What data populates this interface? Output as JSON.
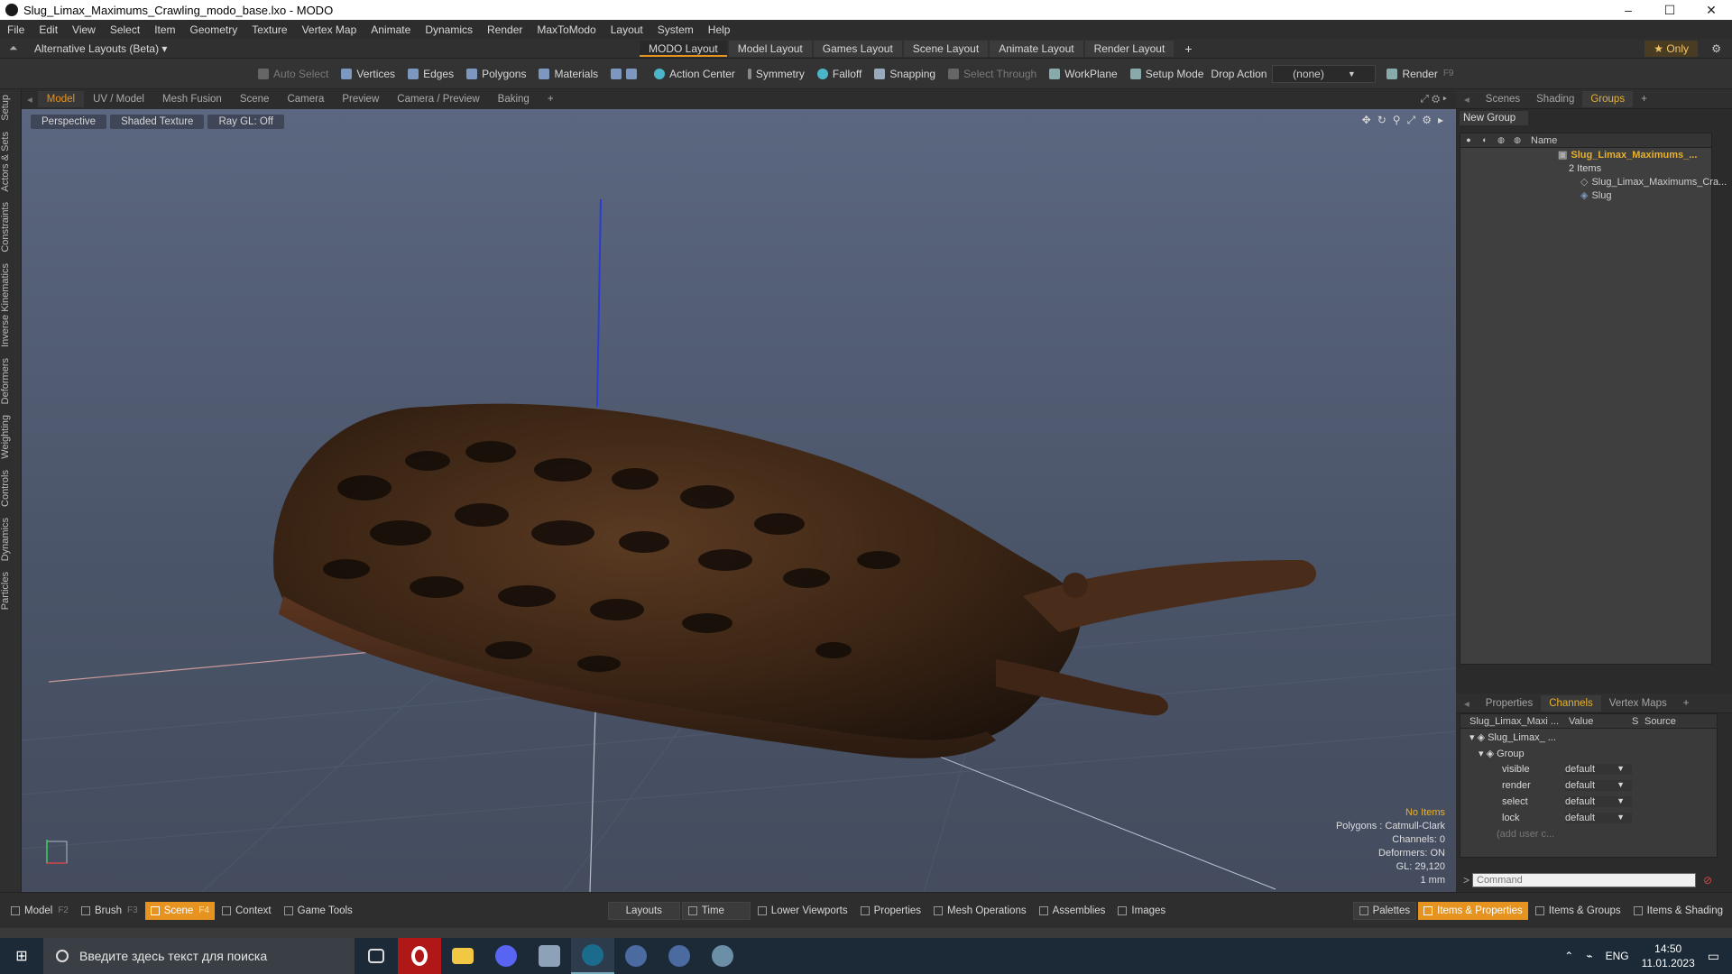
{
  "window": {
    "title": "Slug_Limax_Maximums_Crawling_modo_base.lxo - MODO",
    "controls": [
      "–",
      "☐",
      "✕"
    ]
  },
  "menu": [
    "File",
    "Edit",
    "View",
    "Select",
    "Item",
    "Geometry",
    "Texture",
    "Vertex Map",
    "Animate",
    "Dynamics",
    "Render",
    "MaxToModo",
    "Layout",
    "System",
    "Help"
  ],
  "layoutbar": {
    "alt_layouts": "Alternative Layouts (Beta) ▾",
    "tabs": [
      "MODO Layout",
      "Model Layout",
      "Games Layout",
      "Scene Layout",
      "Animate Layout",
      "Render Layout"
    ],
    "add": "+",
    "only": "★ Only"
  },
  "toolbar": {
    "auto_select": "Auto Select",
    "vertices": "Vertices",
    "edges": "Edges",
    "polygons": "Polygons",
    "materials": "Materials",
    "action_center": "Action Center",
    "symmetry": "Symmetry",
    "falloff": "Falloff",
    "snapping": "Snapping",
    "select_through": "Select Through",
    "workplane": "WorkPlane",
    "setup_mode": "Setup Mode",
    "drop_action": "Drop Action",
    "drop_value": "(none)",
    "render": "Render",
    "render_key": "F9"
  },
  "left_tabs": [
    "Setup",
    "Actors & Sets",
    "Constraints",
    "Inverse Kinematics",
    "Deformers",
    "Weighting",
    "Controls",
    "Dynamics",
    "Particles"
  ],
  "view_tabs": [
    "Model",
    "UV / Model",
    "Mesh Fusion",
    "Scene",
    "Camera",
    "Preview",
    "Camera / Preview",
    "Baking",
    "+"
  ],
  "viewport": {
    "perspective": "Perspective",
    "shading": "Shaded Texture",
    "raygl": "Ray GL: Off",
    "stats": {
      "no_items": "No Items",
      "polygons": "Polygons : Catmull-Clark",
      "channels": "Channels: 0",
      "deformers": "Deformers: ON",
      "gl": "GL: 29,120",
      "scale": "1 mm"
    }
  },
  "right_panel": {
    "tabs": [
      "Scenes",
      "Shading",
      "Groups",
      "+"
    ],
    "new_group": "New Group",
    "name_header": "Name",
    "group_name": "Slug_Limax_Maximums_...",
    "group_count": "2 Items",
    "items": [
      "Slug_Limax_Maximums_Cra...",
      "Slug"
    ]
  },
  "lower_panel": {
    "tabs": [
      "Properties",
      "Channels",
      "Vertex Maps",
      "+"
    ],
    "headers": {
      "name": "Slug_Limax_Maxi ...",
      "value": "Value",
      "s": "S",
      "source": "Source"
    },
    "root": "Slug_Limax_ ...",
    "group": "Group",
    "channels": [
      {
        "name": "visible",
        "value": "default"
      },
      {
        "name": "render",
        "value": "default"
      },
      {
        "name": "select",
        "value": "default"
      },
      {
        "name": "lock",
        "value": "default"
      }
    ],
    "add_user": "(add user c...",
    "command_placeholder": "Command"
  },
  "bottombar": {
    "left": [
      {
        "label": "Model",
        "key": "F2"
      },
      {
        "label": "Brush",
        "key": "F3"
      },
      {
        "label": "Scene",
        "key": "F4"
      },
      {
        "label": "Context",
        "key": ""
      },
      {
        "label": "Game Tools",
        "key": ""
      }
    ],
    "mid": [
      "Layouts",
      "Time",
      "Lower Viewports",
      "Properties",
      "Mesh Operations",
      "Assemblies",
      "Images"
    ],
    "right": [
      "Palettes",
      "Items & Properties",
      "Items & Groups",
      "Items & Shading"
    ]
  },
  "taskbar": {
    "search_placeholder": "Введите здесь текст для поиска",
    "lang": "ENG",
    "time": "14:50",
    "date": "11.01.2023"
  },
  "colors": {
    "accent": "#e7931f",
    "highlight": "#e7b12f"
  }
}
